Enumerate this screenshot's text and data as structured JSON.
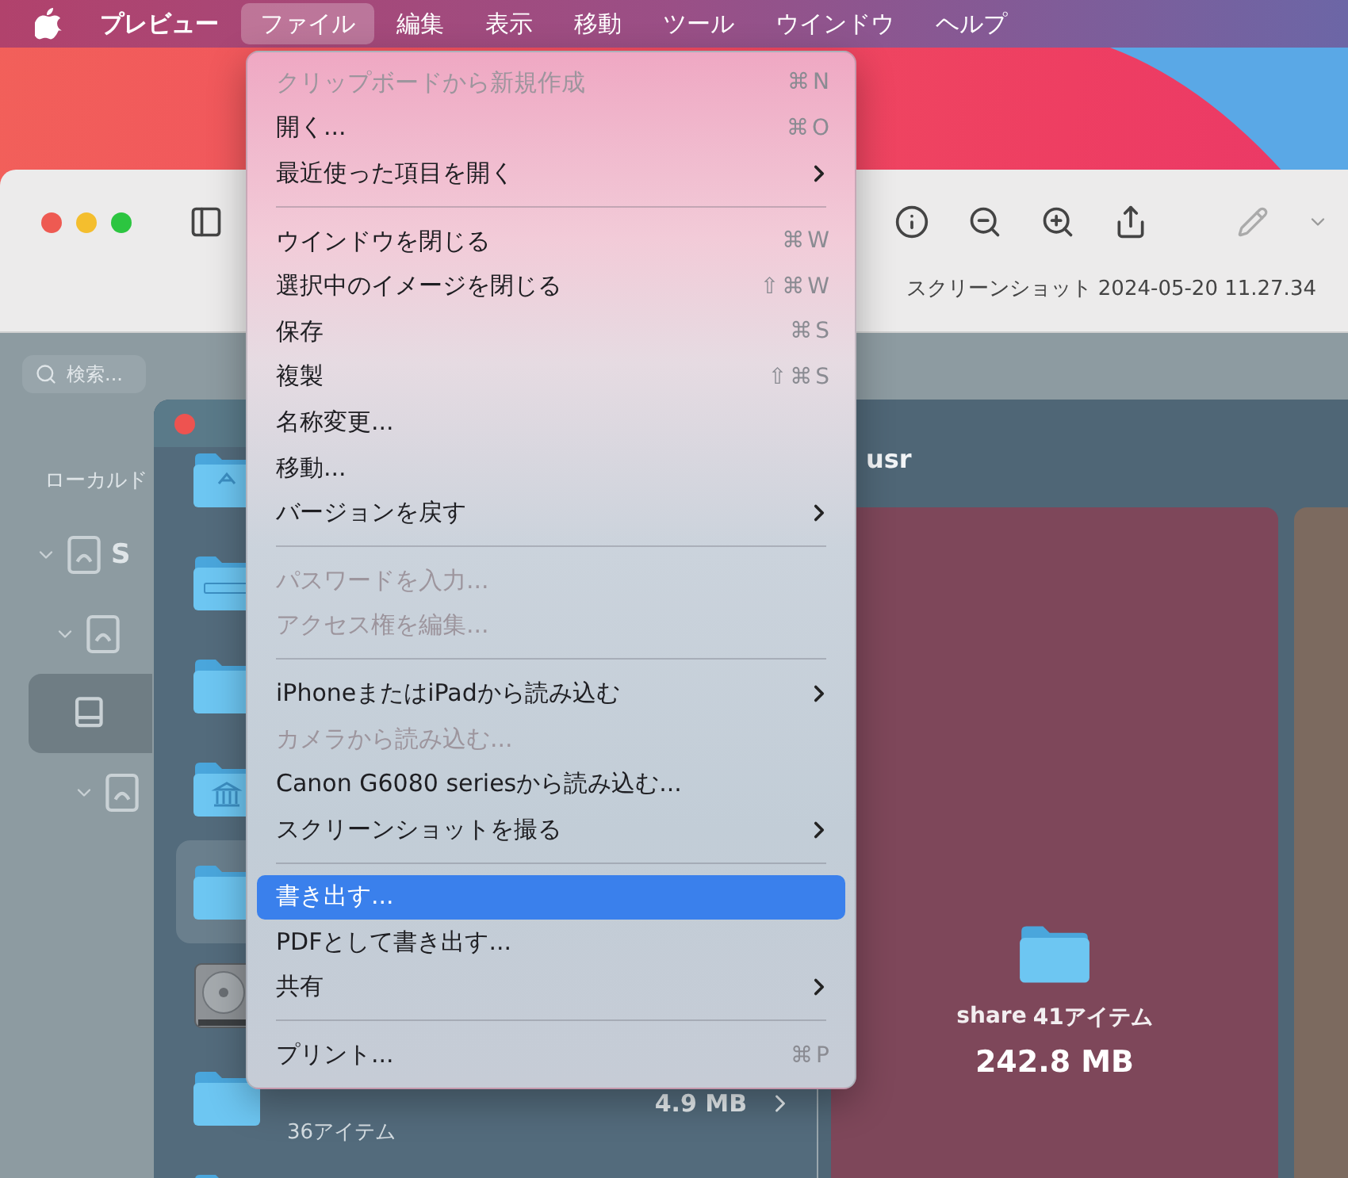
{
  "menubar": {
    "items": [
      {
        "label": "プレビュー",
        "kind": "app",
        "selected": false
      },
      {
        "label": "ファイル",
        "kind": "menu",
        "selected": true
      },
      {
        "label": "編集",
        "kind": "menu",
        "selected": false
      },
      {
        "label": "表示",
        "kind": "menu",
        "selected": false
      },
      {
        "label": "移動",
        "kind": "menu",
        "selected": false
      },
      {
        "label": "ツール",
        "kind": "menu",
        "selected": false
      },
      {
        "label": "ウインドウ",
        "kind": "menu",
        "selected": false
      },
      {
        "label": "ヘルプ",
        "kind": "menu",
        "selected": false
      }
    ]
  },
  "preview_window": {
    "title": "スクリーンショット 2024-05-20 11.27.34"
  },
  "document": {
    "search": {
      "placeholder": "検索..."
    },
    "sidebar_heading": "ローカルド",
    "tree": [
      {
        "label": "S",
        "expanded": true,
        "selected": false,
        "children": [
          {
            "expanded": true,
            "selected": false,
            "children": [
              {
                "selected": true
              },
              {
                "expanded": true,
                "selected": false
              }
            ]
          }
        ]
      }
    ],
    "list_rows": [
      {
        "kind": "app-folder",
        "selected": false
      },
      {
        "kind": "system-folder",
        "selected": false
      },
      {
        "kind": "folder",
        "selected": false
      },
      {
        "kind": "library-folder",
        "selected": false
      },
      {
        "kind": "folder",
        "selected": true
      },
      {
        "kind": "disk",
        "selected": false
      },
      {
        "kind": "folder",
        "selected": false,
        "size": "4.9 MB",
        "count": "36アイテム"
      },
      {
        "kind": "folder",
        "selected": false
      }
    ],
    "panel_title": "usr",
    "cards": [
      {
        "name": "share",
        "count": "41アイテム",
        "size": "242.8 MB",
        "color": "#7e475a"
      },
      {
        "color": "#7c6a5f"
      }
    ]
  },
  "menu": {
    "items": [
      {
        "kind": "item",
        "label": "クリップボードから新規作成",
        "shortcut": "⌘N",
        "disabled": true,
        "submenu": false,
        "selected": false
      },
      {
        "kind": "item",
        "label": "開く...",
        "shortcut": "⌘O",
        "disabled": false,
        "submenu": false,
        "selected": false
      },
      {
        "kind": "item",
        "label": "最近使った項目を開く",
        "disabled": false,
        "submenu": true,
        "selected": false
      },
      {
        "kind": "separator"
      },
      {
        "kind": "item",
        "label": "ウインドウを閉じる",
        "shortcut": "⌘W",
        "disabled": false,
        "submenu": false,
        "selected": false
      },
      {
        "kind": "item",
        "label": "選択中のイメージを閉じる",
        "shortcut": "⇧⌘W",
        "disabled": false,
        "submenu": false,
        "selected": false
      },
      {
        "kind": "item",
        "label": "保存",
        "shortcut": "⌘S",
        "disabled": false,
        "submenu": false,
        "selected": false
      },
      {
        "kind": "item",
        "label": "複製",
        "shortcut": "⇧⌘S",
        "disabled": false,
        "submenu": false,
        "selected": false
      },
      {
        "kind": "item",
        "label": "名称変更...",
        "disabled": false,
        "submenu": false,
        "selected": false
      },
      {
        "kind": "item",
        "label": "移動...",
        "disabled": false,
        "submenu": false,
        "selected": false
      },
      {
        "kind": "item",
        "label": "バージョンを戻す",
        "disabled": false,
        "submenu": true,
        "selected": false
      },
      {
        "kind": "separator"
      },
      {
        "kind": "item",
        "label": "パスワードを入力...",
        "disabled": true,
        "submenu": false,
        "selected": false
      },
      {
        "kind": "item",
        "label": "アクセス権を編集...",
        "disabled": true,
        "submenu": false,
        "selected": false
      },
      {
        "kind": "separator"
      },
      {
        "kind": "item",
        "label": "iPhoneまたはiPadから読み込む",
        "disabled": false,
        "submenu": true,
        "selected": false
      },
      {
        "kind": "item",
        "label": "カメラから読み込む...",
        "disabled": true,
        "submenu": false,
        "selected": false
      },
      {
        "kind": "item",
        "label": "Canon G6080 seriesから読み込む...",
        "disabled": false,
        "submenu": false,
        "selected": false
      },
      {
        "kind": "item",
        "label": "スクリーンショットを撮る",
        "disabled": false,
        "submenu": true,
        "selected": false
      },
      {
        "kind": "separator"
      },
      {
        "kind": "item",
        "label": "書き出す...",
        "disabled": false,
        "submenu": false,
        "selected": true
      },
      {
        "kind": "item",
        "label": "PDFとして書き出す...",
        "disabled": false,
        "submenu": false,
        "selected": false
      },
      {
        "kind": "item",
        "label": "共有",
        "disabled": false,
        "submenu": true,
        "selected": false
      },
      {
        "kind": "separator"
      },
      {
        "kind": "item",
        "label": "プリント...",
        "shortcut": "⌘P",
        "disabled": false,
        "submenu": false,
        "selected": false
      }
    ]
  }
}
